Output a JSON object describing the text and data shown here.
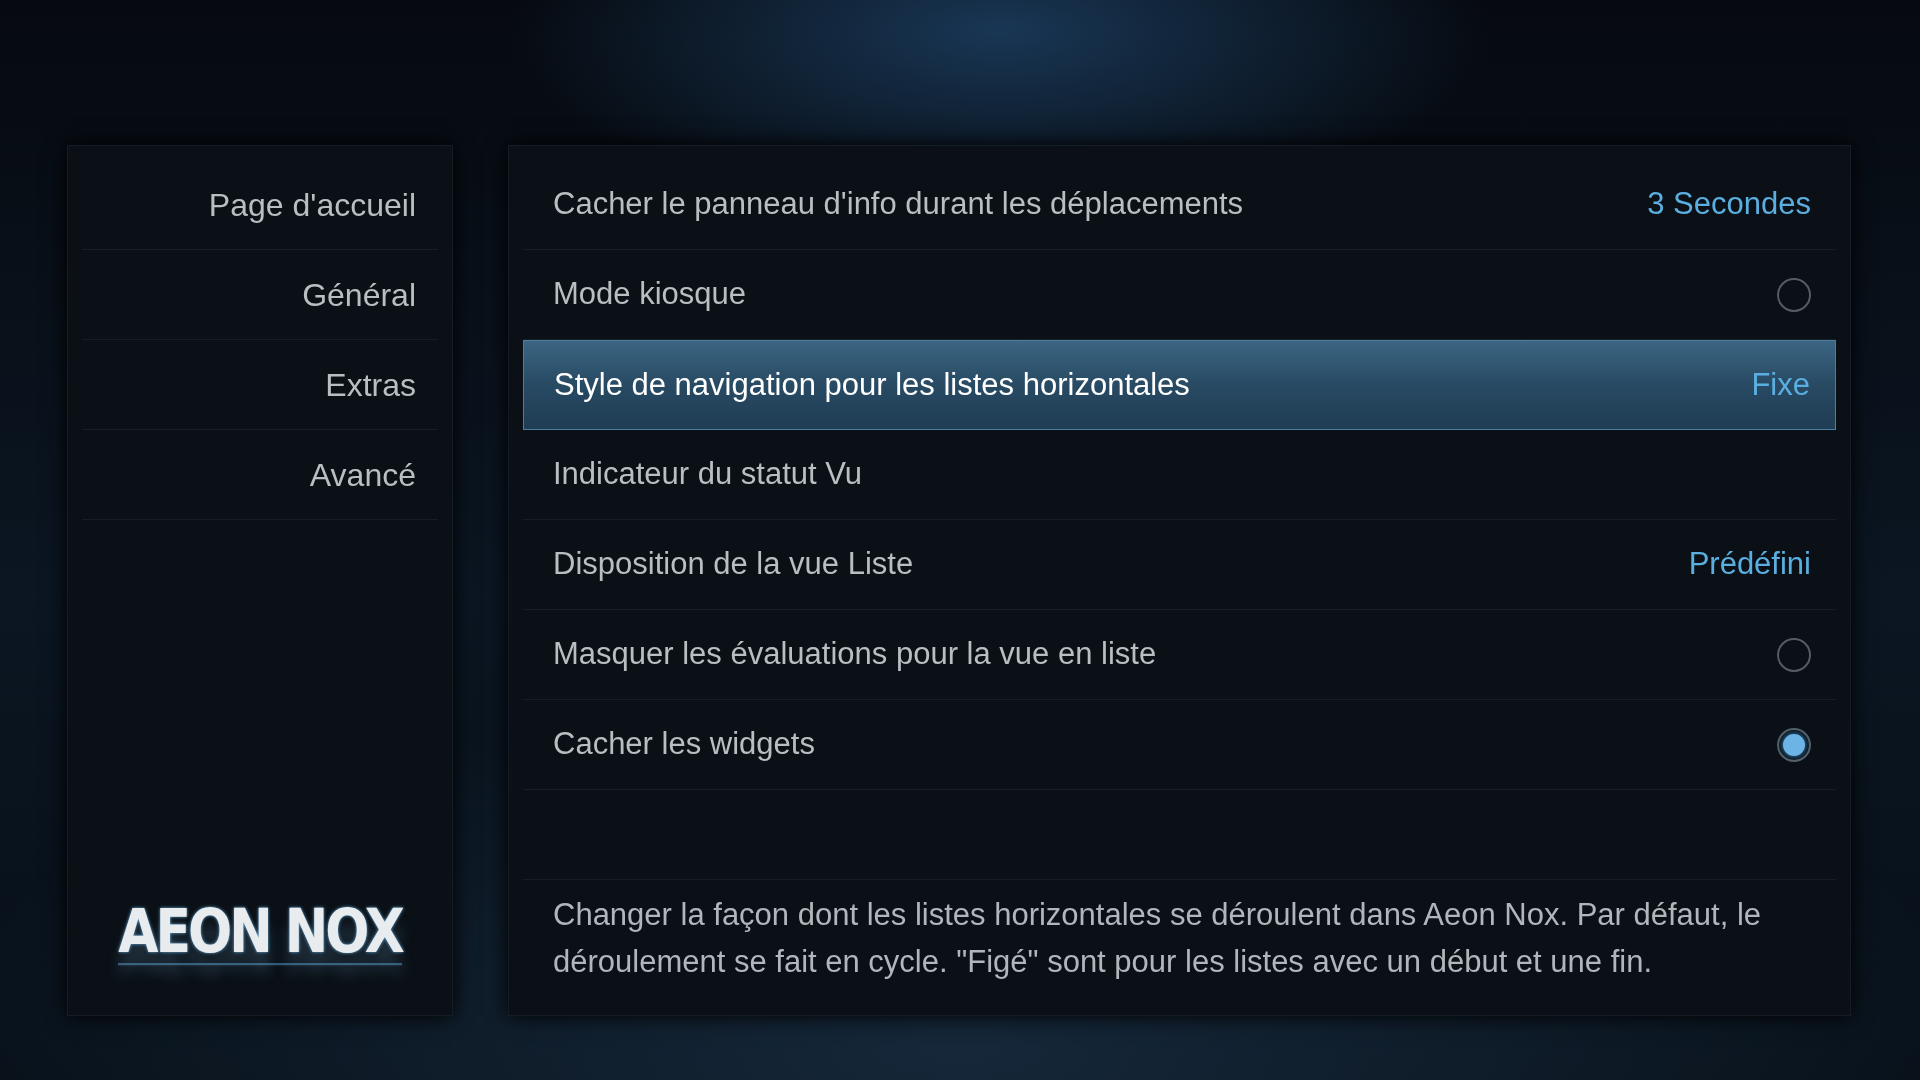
{
  "sidebar": {
    "items": [
      {
        "label": "Page d'accueil"
      },
      {
        "label": "Général"
      },
      {
        "label": "Extras"
      },
      {
        "label": "Avancé"
      }
    ],
    "logo": "AEON NOX"
  },
  "settings": {
    "rows": [
      {
        "kind": "value",
        "label": "Cacher le panneau d'info durant les déplacements",
        "value": "3 Secondes",
        "selected": false
      },
      {
        "kind": "toggle",
        "label": "Mode kiosque",
        "on": false,
        "selected": false
      },
      {
        "kind": "value",
        "label": "Style de navigation pour les listes horizontales",
        "value": "Fixe",
        "selected": true
      },
      {
        "kind": "plain",
        "label": "Indicateur du statut Vu",
        "selected": false
      },
      {
        "kind": "value",
        "label": "Disposition de la vue Liste",
        "value": "Prédéfini",
        "selected": false
      },
      {
        "kind": "toggle",
        "label": "Masquer les évaluations pour la vue en liste",
        "on": false,
        "selected": false
      },
      {
        "kind": "toggle",
        "label": "Cacher les widgets",
        "on": true,
        "selected": false
      }
    ],
    "description": "Changer la façon dont les listes horizontales se déroulent dans Aeon Nox. Par défaut, le déroulement se fait en cycle. \"Figé\" sont pour les listes avec un début et une fin."
  }
}
